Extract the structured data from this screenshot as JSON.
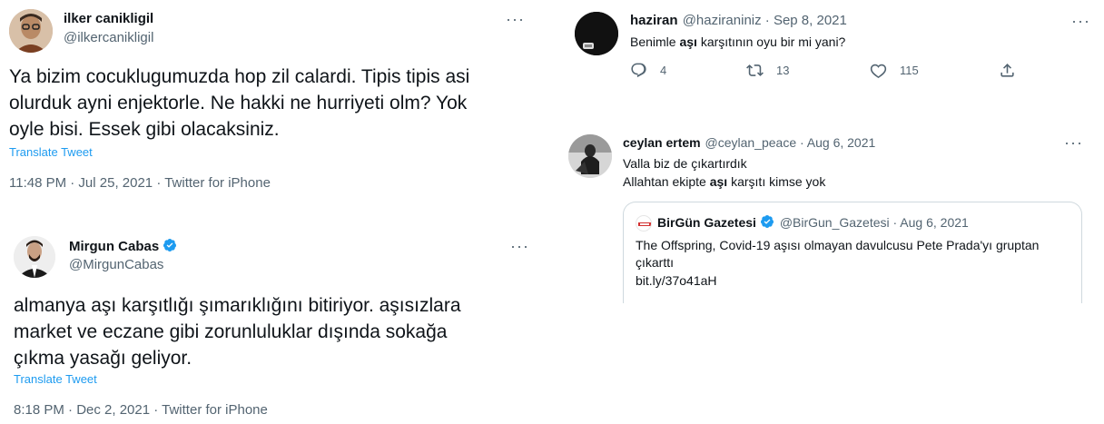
{
  "tweet1": {
    "name": "ilker canikligil",
    "handle": "@ilkercanikligil",
    "text_lines": [
      "Ya bizim cocuklugumuzda hop zil calardi. Tipis tipis asi",
      "olurduk ayni enjektorle. Ne hakki ne hurriyeti olm? Yok",
      "oyle bisi. Essek gibi olacaksiniz."
    ],
    "translate": "Translate Tweet",
    "meta": "11:48 PM · Jul 25, 2021 · Twitter for iPhone"
  },
  "tweet2": {
    "name": "Mirgun Cabas",
    "handle": "@MirgunCabas",
    "text_lines": [
      "almanya aşı karşıtlığı şımarıklığını bitiriyor. aşısızlara",
      "market ve eczane gibi zorunluluklar dışında sokağa",
      "çıkma yasağı geliyor."
    ],
    "translate": "Translate Tweet",
    "meta": "8:18 PM · Dec 2, 2021 · Twitter for iPhone"
  },
  "tweet3": {
    "name": "haziran",
    "handle_date": "@haziraniniz · Sep 8, 2021",
    "text_before": "Benimle ",
    "text_bold": "aşı",
    "text_after": " karşıtının oyu bir mi yani?",
    "replies": "4",
    "retweets": "13",
    "likes": "115"
  },
  "tweet4": {
    "name": "ceylan ertem",
    "handle_date": "@ceylan_peace · Aug 6, 2021",
    "line1": "Valla biz de çıkartırdık",
    "line2_before": "Allahtan ekipte ",
    "line2_bold": "aşı",
    "line2_after": " karşıtı kimse yok",
    "quote": {
      "name": "BirGün Gazetesi",
      "handle_date": "@BirGun_Gazetesi · Aug 6, 2021",
      "line1": "The Offspring, Covid-19 aşısı olmayan davulcusu Pete Prada'yı gruptan",
      "line2": "çıkarttı",
      "link": "bit.ly/37o41aH",
      "logo_text": "BirGün"
    }
  },
  "more_label": "···",
  "colors": {
    "text": "#0f1419",
    "secondary": "#536471",
    "accent": "#1d9bf0",
    "border": "#cfd9de"
  }
}
